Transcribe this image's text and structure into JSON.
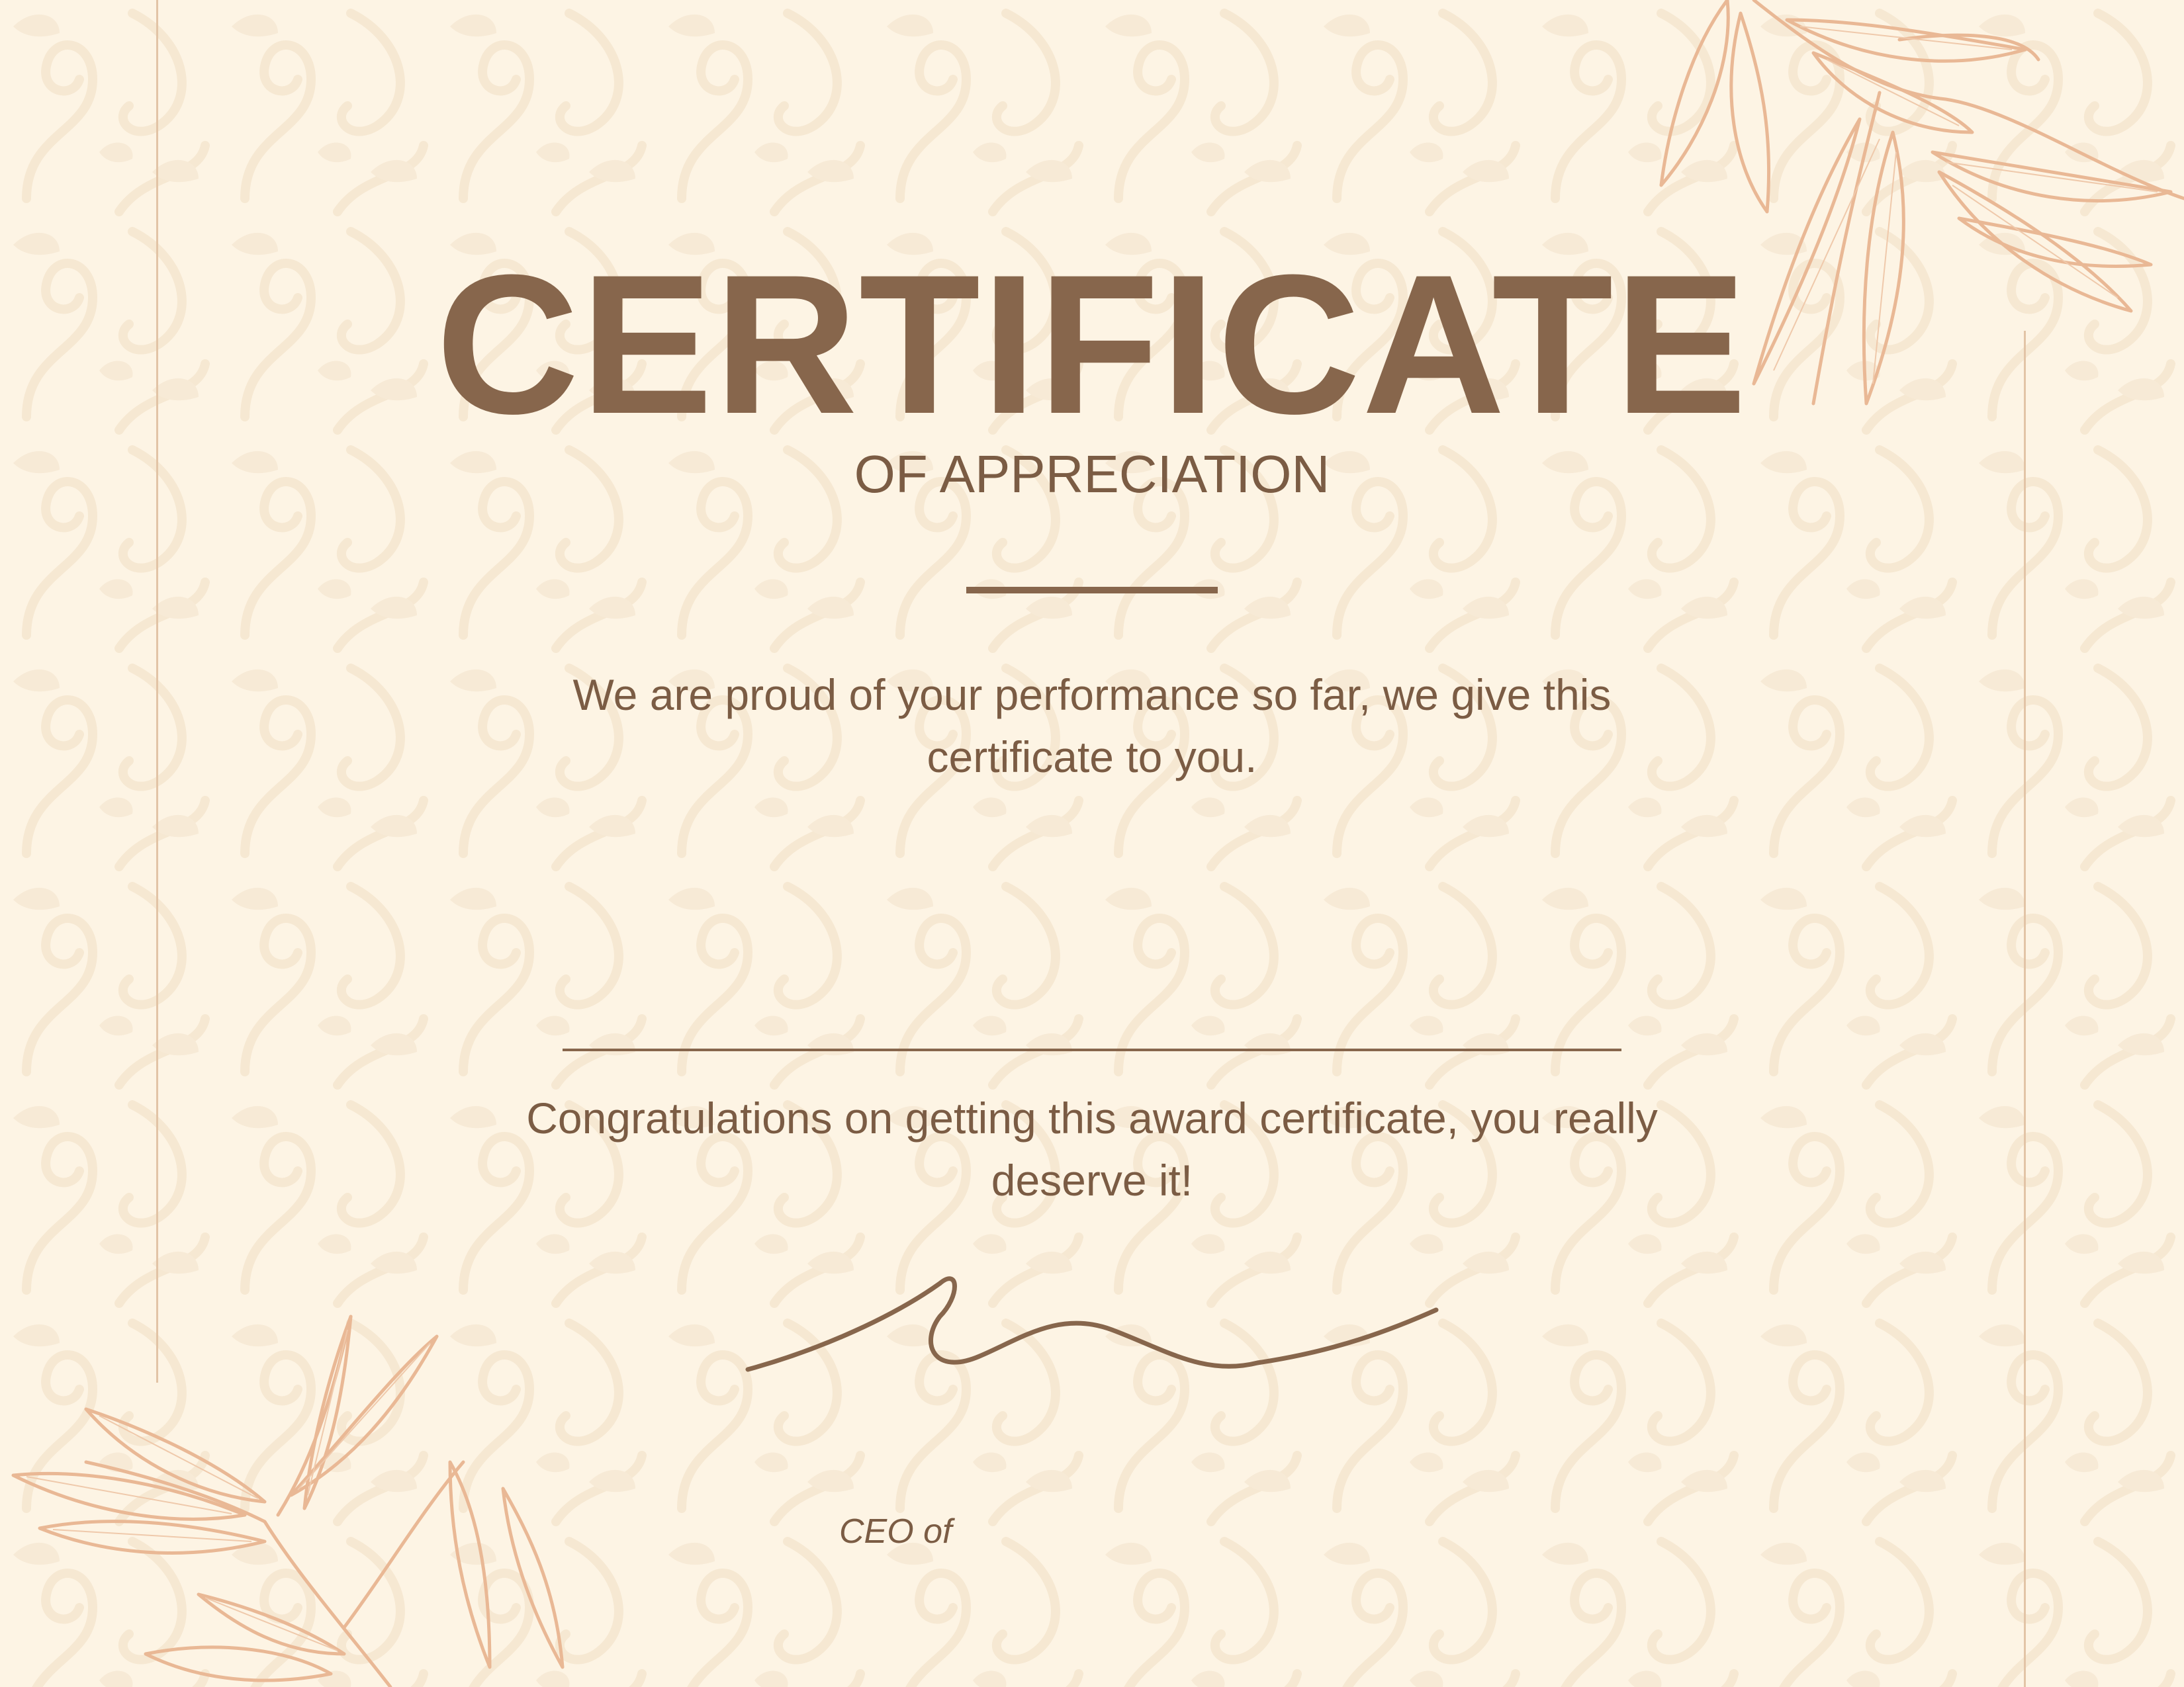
{
  "certificate": {
    "title": "CERTIFICATE",
    "subtitle": "OF APPRECIATION",
    "intro": "We are proud of your performance so far, we give this certificate to you.",
    "congratulations": "Congratulations on getting this award certificate, you really deserve it!",
    "signer_title": "CEO of"
  },
  "colors": {
    "background": "#fdf4e4",
    "text_brown": "#7b5c44",
    "title_brown": "#87664c",
    "leaf_peach": "#e9b895",
    "frame_line": "#e2c4a6"
  },
  "icons": {
    "decoration_top_right": "olive-branch-icon",
    "decoration_bottom_left": "olive-branch-icon",
    "signature": "signature-icon"
  }
}
